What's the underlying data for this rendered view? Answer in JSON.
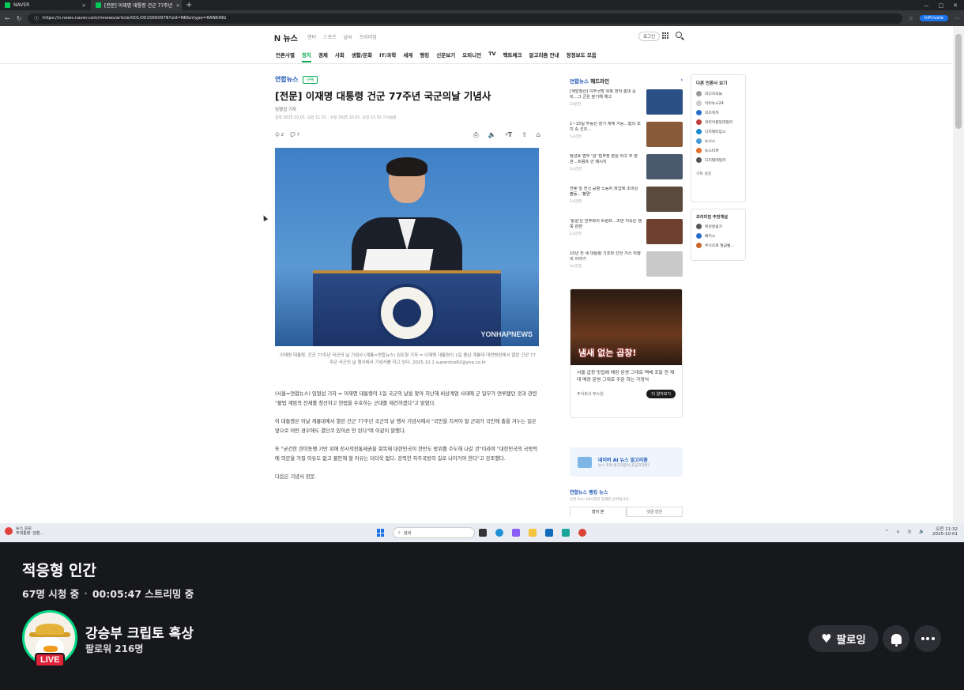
{
  "browser": {
    "tabs": [
      {
        "label": "NAVER"
      },
      {
        "label": "[전문] 이재명 대통령 건군 77주년"
      }
    ],
    "url": "https://n.news.naver.com/mnews/article/001/0015660978?sid=NB&ntype=RANKING",
    "profile": "InPrivate"
  },
  "naver": {
    "logo": "N",
    "logo_text": "뉴스",
    "services": [
      "엔터",
      "스포츠",
      "날씨",
      "프리미엄"
    ],
    "login": "로그인",
    "categories": [
      "언론사별",
      "정치",
      "경제",
      "사회",
      "생활/문화",
      "IT/과학",
      "세계",
      "랭킹",
      "신문보기",
      "오피니언",
      "TV",
      "팩트체크",
      "알고리즘 안내",
      "정정보도 모음"
    ],
    "active_category": "정치"
  },
  "article": {
    "press": "연합뉴스",
    "subscribe": "구독",
    "headline": "[전문] 이재명 대통령 건군 77주년 국군의날 기념사",
    "reporter": "임형섭 기자",
    "dates": "입력 2025.10.01. 오전 11:31 · 수정 2025.10.01. 오전 11:32   기사원문",
    "reactions": "2",
    "comments": "7",
    "photo_watermark": "YONHAPNEWS",
    "caption": "이재명 대통령, 건군 77주년 국군의 날 기념사 (계룡=연합뉴스) 임도형 기자 = 이재명 대통령이 1일 충남 계룡대 대연병장에서 열린 건군 77주년 국군의 날 행사에서 기념사를 하고 있다. 2025.10.1 superdoo82@yna.co.kr",
    "paragraphs": [
      "(서울=연합뉴스) 임형섭 기자 = 이재명 대통령이 1일 국군의 날을 맞아 지난해 비상계엄 사태에 군 일부가 연루됐던 것과 관련 \"불법 계엄의 잔재를 청산하고 헌법을 수호하는 군대를 재건하겠다\"고 밝혔다.",
      "이 대통령은 이날 계룡대에서 열린 건군 77주년 국군의 날 행사 기념사에서 \"국민을 지켜야 할 군대가 국민에 총을 겨누는 일은 앞으로 어떤 경우에도 결단코 있어선 안 된다\"며 이같이 말했다.",
      "또 \"굳건한 한미동맹 기반 위에 전시작전통제권을 회복해 대한민국이 한반도 방위를 주도해 나갈 것\"이라며 \"대한민국의 국방력에 의문을 가질 이유도 없고 불안해 할 이유는 더더욱 없다. 강력한 자주국방의 길로 나아가야 한다\"고 강조했다.",
      "다음은 기념사 전문."
    ]
  },
  "sidebar": {
    "headline_press": "연합뉴스",
    "headline_label": "헤드라인",
    "news": [
      {
        "title": "[계엄청산] 이주국방 회복 먼저 총대 준비…그 군은 분기해 예고",
        "time": "23분전",
        "color": "#2c4f86"
      },
      {
        "title": "1~15일 부동산 장기 체계 가능…합의 조치 속 선조…",
        "time": "1시간전",
        "color": "#8a5a3a"
      },
      {
        "title": "정성호 법무 '검' 법무장 본원 하고 추 장관…트럼프 안 메시지",
        "time": "1시간전",
        "color": "#4a5a6e"
      },
      {
        "title": "연휴 앞 전국 공항 노동자 파업에 초비상 출동…'불편'",
        "time": "2시간전",
        "color": "#5a4a3e"
      },
      {
        "title": "'통일'은 민주화의 트럼프…초반 지속은 쟁 쭉 관련",
        "time": "2시간전",
        "color": "#6e4030"
      },
      {
        "title": "10년 전 세 대통령 기조와 선언 가스 여행의 이야기",
        "time": "3시간전",
        "color": "#c9c9c9"
      }
    ],
    "ad_headline": "냄새 없는 곱창!",
    "ad_text": "서울 곱창 맛집에 매장 운영 그대로 택배 조달 한 제대 매장 운영 그대로 주문 하는 가정식",
    "ad_advertiser": "주식회사 무스원",
    "ad_button": "더 알아보기",
    "ai_title": "네이버 AI 뉴스 알고리즘",
    "ai_sub": "뉴스 추천 알고리즘이 궁금하다면?",
    "ranking_title": "연합뉴스 랭킹 뉴스",
    "ranking_sub": "오전 9시~10시까지 집계된 순위입니다.",
    "ranking_tabs": [
      "많이 본",
      "댓글 많은"
    ]
  },
  "press_box": {
    "title": "다른 언론사 보기",
    "items": [
      {
        "name": "미디어오늘",
        "color": "#999999"
      },
      {
        "name": "아이뉴스24",
        "color": "#cccccc"
      },
      {
        "name": "비즈워치",
        "color": "#2a6ecb"
      },
      {
        "name": "코리아중앙데일리",
        "color": "#c33c3c"
      },
      {
        "name": "디지털타임스",
        "color": "#1a8acb"
      },
      {
        "name": "뉴시스",
        "color": "#4a9ad6"
      },
      {
        "name": "뉴스타파",
        "color": "#e46d2b"
      },
      {
        "name": "디지털데일리",
        "color": "#555555"
      }
    ],
    "more": "구독 설정"
  },
  "reco_box": {
    "title": "프리미엄 추천채널",
    "items": [
      {
        "name": "위성방송가",
        "color": "#555555"
      },
      {
        "name": "베이스",
        "color": "#2a6ecb"
      },
      {
        "name": "주식으로 월급벌…",
        "color": "#c9662c"
      }
    ]
  },
  "taskbar": {
    "weather_line1": "뉴스 속보",
    "weather_line2": "주대통령 '검찰…",
    "search_placeholder": "검색",
    "time": "오전 11:32",
    "date": "2025-10-01",
    "lang": "가"
  },
  "stream": {
    "title": "적응형 인간",
    "viewers": "67명 시청 중",
    "duration": "00:05:47 스트리밍 중",
    "channel": "강승부 크립토 혹상",
    "followers": "팔로워 216명",
    "live": "LIVE",
    "follow": "팔로잉"
  }
}
